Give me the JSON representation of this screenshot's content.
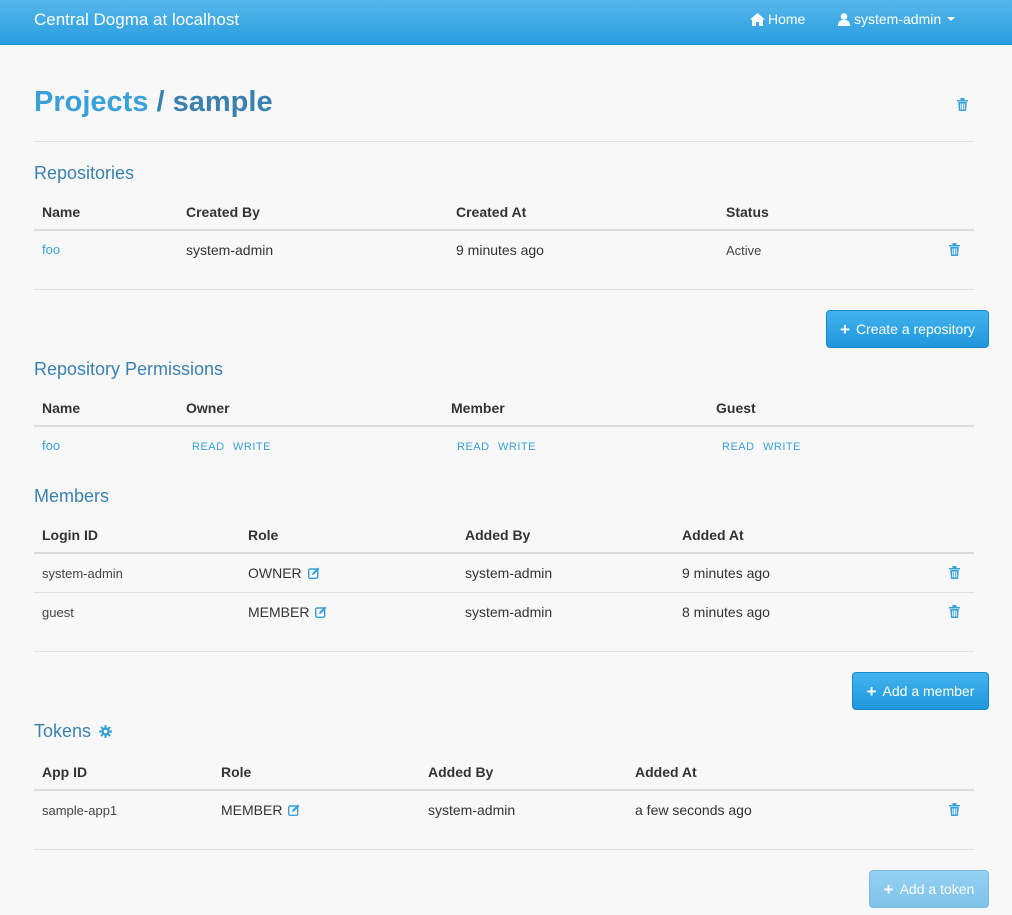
{
  "navbar": {
    "brand": "Central Dogma at localhost",
    "home_label": "Home",
    "user_label": "system-admin"
  },
  "header": {
    "projects_link": "Projects",
    "separator": "/",
    "project_name": "sample"
  },
  "repositories": {
    "title": "Repositories",
    "columns": [
      "Name",
      "Created By",
      "Created At",
      "Status"
    ],
    "rows": [
      {
        "name": "foo",
        "created_by": "system-admin",
        "created_at": "9 minutes ago",
        "status": "Active"
      }
    ],
    "create_button": "Create a repository"
  },
  "permissions": {
    "title": "Repository Permissions",
    "columns": [
      "Name",
      "Owner",
      "Member",
      "Guest"
    ],
    "rows": [
      {
        "name": "foo",
        "owner": [
          "READ",
          "WRITE"
        ],
        "member": [
          "READ",
          "WRITE"
        ],
        "guest": [
          "READ",
          "WRITE"
        ]
      }
    ]
  },
  "members": {
    "title": "Members",
    "columns": [
      "Login ID",
      "Role",
      "Added By",
      "Added At"
    ],
    "rows": [
      {
        "login_id": "system-admin",
        "role": "OWNER",
        "added_by": "system-admin",
        "added_at": "9 minutes ago"
      },
      {
        "login_id": "guest",
        "role": "MEMBER",
        "added_by": "system-admin",
        "added_at": "8 minutes ago"
      }
    ],
    "add_button": "Add a member"
  },
  "tokens": {
    "title": "Tokens",
    "columns": [
      "App ID",
      "Role",
      "Added By",
      "Added At"
    ],
    "rows": [
      {
        "app_id": "sample-app1",
        "role": "MEMBER",
        "added_by": "system-admin",
        "added_at": "a few seconds ago"
      }
    ],
    "add_button": "Add a token"
  },
  "icons": {
    "home": "home-icon",
    "user": "user-icon",
    "trash": "trash-icon",
    "edit": "edit-icon",
    "gear": "gear-icon",
    "plus": "plus-icon"
  },
  "colors": {
    "navbar": "#2a9ee0",
    "accent": "#3aa0d8",
    "heading": "#3b81b0"
  }
}
